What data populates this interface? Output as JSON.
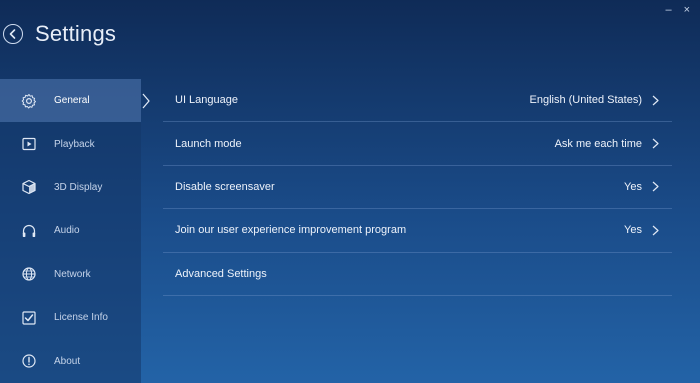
{
  "window": {
    "minimize_label": "–",
    "close_label": "×"
  },
  "header": {
    "title": "Settings",
    "back_icon": "back-arrow-icon"
  },
  "sidebar": {
    "items": [
      {
        "label": "General",
        "icon": "gear-icon",
        "active": true
      },
      {
        "label": "Playback",
        "icon": "play-icon",
        "active": false
      },
      {
        "label": "3D Display",
        "icon": "cube-icon",
        "active": false
      },
      {
        "label": "Audio",
        "icon": "headphones-icon",
        "active": false
      },
      {
        "label": "Network",
        "icon": "globe-icon",
        "active": false
      },
      {
        "label": "License Info",
        "icon": "checkbox-icon",
        "active": false
      },
      {
        "label": "About",
        "icon": "info-icon",
        "active": false
      }
    ]
  },
  "settings": {
    "rows": [
      {
        "label": "UI Language",
        "value": "English (United States)",
        "has_chevron": true
      },
      {
        "label": "Launch mode",
        "value": "Ask me each time",
        "has_chevron": true
      },
      {
        "label": "Disable screensaver",
        "value": "Yes",
        "has_chevron": true
      },
      {
        "label": "Join our user experience improvement program",
        "value": "Yes",
        "has_chevron": true
      },
      {
        "label": "Advanced Settings",
        "value": "",
        "has_chevron": false
      }
    ]
  },
  "colors": {
    "background_top": "#0f2b57",
    "background_bottom": "#2363a7",
    "sidebar_active": "#547cb4",
    "text": "#ffffff"
  }
}
